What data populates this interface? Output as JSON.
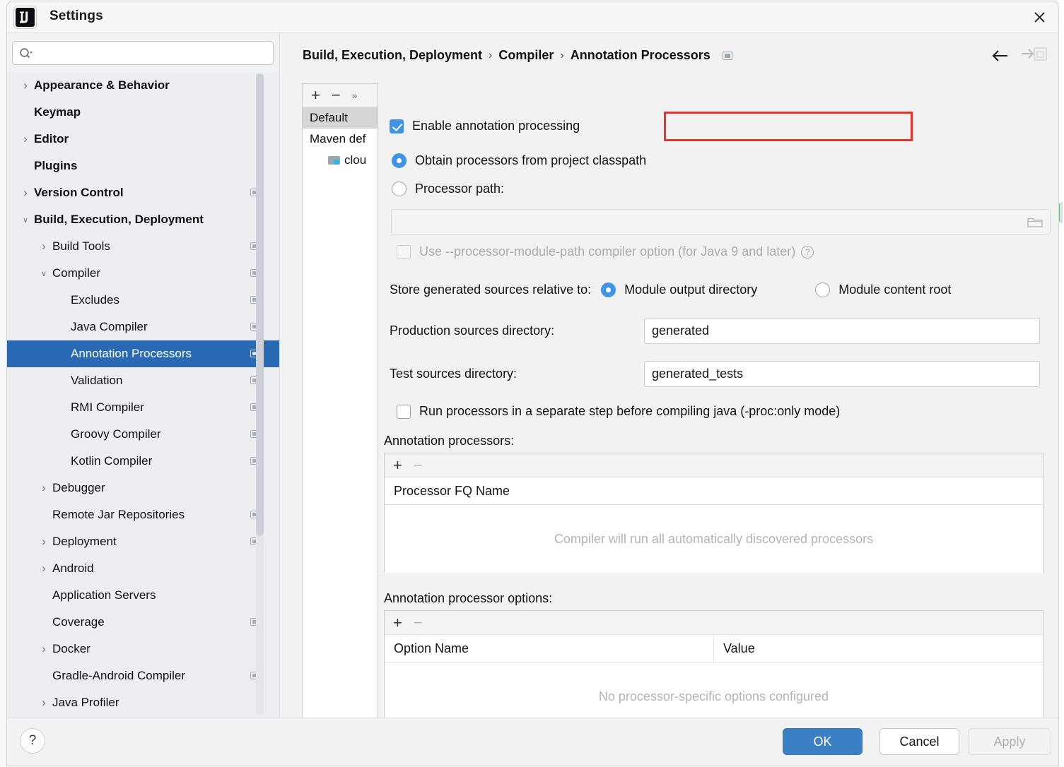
{
  "window": {
    "title": "Settings",
    "logo_icon": "intellij-idea-logo",
    "close_icon": "close-icon"
  },
  "search": {
    "value": "",
    "placeholder": "",
    "icon": "search-icon"
  },
  "sidebar": {
    "items": [
      {
        "label": "Appearance & Behavior",
        "indent": 1,
        "arrow": "collapsed",
        "bold": true,
        "badge": false,
        "selected": false
      },
      {
        "label": "Keymap",
        "indent": 1,
        "arrow": "none",
        "bold": true,
        "badge": false,
        "selected": false
      },
      {
        "label": "Editor",
        "indent": 1,
        "arrow": "collapsed",
        "bold": true,
        "badge": false,
        "selected": false
      },
      {
        "label": "Plugins",
        "indent": 1,
        "arrow": "none",
        "bold": true,
        "badge": false,
        "selected": false
      },
      {
        "label": "Version Control",
        "indent": 1,
        "arrow": "collapsed",
        "bold": true,
        "badge": true,
        "selected": false
      },
      {
        "label": "Build, Execution, Deployment",
        "indent": 1,
        "arrow": "expanded",
        "bold": true,
        "badge": false,
        "selected": false
      },
      {
        "label": "Build Tools",
        "indent": 2,
        "arrow": "collapsed",
        "bold": false,
        "badge": true,
        "selected": false
      },
      {
        "label": "Compiler",
        "indent": 2,
        "arrow": "expanded",
        "bold": false,
        "badge": true,
        "selected": false
      },
      {
        "label": "Excludes",
        "indent": 3,
        "arrow": "none",
        "bold": false,
        "badge": true,
        "selected": false
      },
      {
        "label": "Java Compiler",
        "indent": 3,
        "arrow": "none",
        "bold": false,
        "badge": true,
        "selected": false
      },
      {
        "label": "Annotation Processors",
        "indent": 3,
        "arrow": "none",
        "bold": false,
        "badge": true,
        "selected": true
      },
      {
        "label": "Validation",
        "indent": 3,
        "arrow": "none",
        "bold": false,
        "badge": true,
        "selected": false
      },
      {
        "label": "RMI Compiler",
        "indent": 3,
        "arrow": "none",
        "bold": false,
        "badge": true,
        "selected": false
      },
      {
        "label": "Groovy Compiler",
        "indent": 3,
        "arrow": "none",
        "bold": false,
        "badge": true,
        "selected": false
      },
      {
        "label": "Kotlin Compiler",
        "indent": 3,
        "arrow": "none",
        "bold": false,
        "badge": true,
        "selected": false
      },
      {
        "label": "Debugger",
        "indent": 2,
        "arrow": "collapsed",
        "bold": false,
        "badge": false,
        "selected": false
      },
      {
        "label": "Remote Jar Repositories",
        "indent": 2,
        "arrow": "none",
        "bold": false,
        "badge": true,
        "selected": false
      },
      {
        "label": "Deployment",
        "indent": 2,
        "arrow": "collapsed",
        "bold": false,
        "badge": true,
        "selected": false
      },
      {
        "label": "Android",
        "indent": 2,
        "arrow": "collapsed",
        "bold": false,
        "badge": false,
        "selected": false
      },
      {
        "label": "Application Servers",
        "indent": 2,
        "arrow": "none",
        "bold": false,
        "badge": false,
        "selected": false
      },
      {
        "label": "Coverage",
        "indent": 2,
        "arrow": "none",
        "bold": false,
        "badge": true,
        "selected": false
      },
      {
        "label": "Docker",
        "indent": 2,
        "arrow": "collapsed",
        "bold": false,
        "badge": false,
        "selected": false
      },
      {
        "label": "Gradle-Android Compiler",
        "indent": 2,
        "arrow": "none",
        "bold": false,
        "badge": true,
        "selected": false
      },
      {
        "label": "Java Profiler",
        "indent": 2,
        "arrow": "collapsed",
        "bold": false,
        "badge": false,
        "selected": false
      }
    ]
  },
  "breadcrumb": {
    "parts": [
      "Build, Execution, Deployment",
      "Compiler",
      "Annotation Processors"
    ],
    "separator": "›",
    "badge_icon": "project-setting-badge-icon",
    "back_icon": "arrow-left-icon",
    "forward_icon": "arrow-right-icon"
  },
  "profiles": {
    "toolbar": {
      "add": "+",
      "remove": "−",
      "more": "»"
    },
    "rows": [
      {
        "label": "Default",
        "selected": true,
        "icon": null,
        "child": false
      },
      {
        "label": "Maven def",
        "selected": false,
        "icon": null,
        "child": false
      },
      {
        "label": "clou",
        "selected": false,
        "icon": "module-icon",
        "child": true
      }
    ]
  },
  "form": {
    "enable_annotation_processing": {
      "label": "Enable annotation processing",
      "checked": true
    },
    "source_mode": {
      "options": [
        {
          "label": "Obtain processors from project classpath",
          "selected": true
        },
        {
          "label": "Processor path:",
          "selected": false
        }
      ]
    },
    "processor_path": {
      "value": "",
      "browse_icon": "folder-icon",
      "disabled": true
    },
    "module_path_option": {
      "label": "Use --processor-module-path compiler option (for Java 9 and later)",
      "checked": false,
      "disabled": true,
      "help_icon": "help-icon"
    },
    "store_generated": {
      "label": "Store generated sources relative to:",
      "options": [
        {
          "label": "Module output directory",
          "selected": true
        },
        {
          "label": "Module content root",
          "selected": false
        }
      ]
    },
    "production_sources": {
      "label": "Production sources directory:",
      "value": "generated"
    },
    "test_sources": {
      "label": "Test sources directory:",
      "value": "generated_tests"
    },
    "proc_only": {
      "label": "Run processors in a separate step before compiling java (-proc:only mode)",
      "checked": false
    },
    "processors_table": {
      "title": "Annotation processors:",
      "toolbar": {
        "add": "+",
        "remove": "−"
      },
      "columns": [
        "Processor FQ Name"
      ],
      "rows": [],
      "empty_text": "Compiler will run all automatically discovered processors"
    },
    "options_table": {
      "title": "Annotation processor options:",
      "toolbar": {
        "add": "+",
        "remove": "−"
      },
      "columns": [
        "Option Name",
        "Value"
      ],
      "rows": [],
      "empty_text": "No processor-specific options configured"
    }
  },
  "footer": {
    "help_label": "?",
    "ok_label": "OK",
    "cancel_label": "Cancel",
    "apply_label": "Apply"
  },
  "colors": {
    "accent_blue": "#3f94e8",
    "selection_blue": "#2a6ab5",
    "ok_button_blue": "#3b7fc4",
    "highlight_red": "#e8312a",
    "module_icon_blue": "#39b2e5"
  }
}
